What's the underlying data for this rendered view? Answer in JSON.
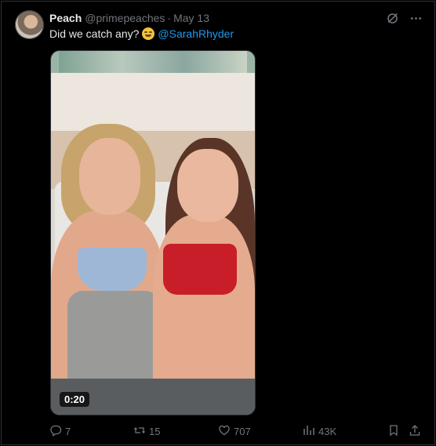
{
  "tweet": {
    "display_name": "Peach",
    "handle": "@primepeaches",
    "separator": "·",
    "date": "May 13",
    "text_before": "Did we catch any?",
    "mention": "@SarahRhyder",
    "emoji": "grimacing-face-emoji"
  },
  "video": {
    "duration": "0:20"
  },
  "actions": {
    "replies": "7",
    "reposts": "15",
    "likes": "707",
    "views": "43K"
  },
  "icons": {
    "grok": "grok-icon",
    "more": "more-icon",
    "reply": "reply-icon",
    "repost": "repost-icon",
    "like": "like-icon",
    "views": "views-icon",
    "bookmark": "bookmark-icon",
    "share": "share-icon"
  },
  "colors": {
    "background": "#000000",
    "text_primary": "#e7e9ea",
    "text_secondary": "#71767b",
    "link": "#1d9bf0",
    "border": "#2f3336"
  }
}
